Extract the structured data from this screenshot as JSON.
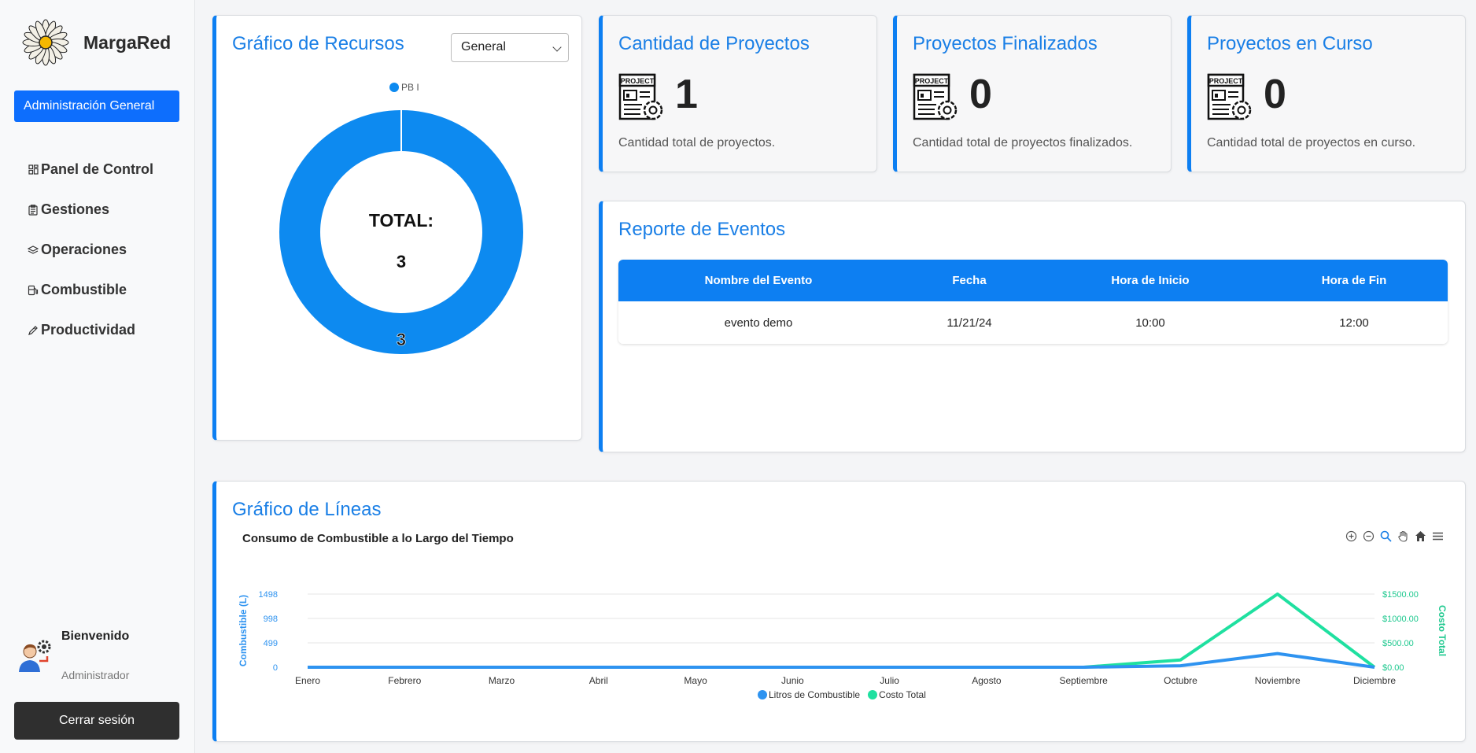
{
  "sidebar": {
    "brand": "MargaRed",
    "admin_button": "Administración General",
    "items": [
      {
        "label": "Panel de Control",
        "icon": "dashboard-icon"
      },
      {
        "label": "Gestiones",
        "icon": "clipboard-icon"
      },
      {
        "label": "Operaciones",
        "icon": "layers-icon"
      },
      {
        "label": "Combustible",
        "icon": "fuel-pump-icon"
      },
      {
        "label": "Productividad",
        "icon": "pencil-icon"
      }
    ],
    "welcome_title": "Bienvenido",
    "welcome_role": "Administrador",
    "logout": "Cerrar sesión"
  },
  "resources": {
    "title": "Gráfico de Recursos",
    "select_value": "General",
    "legend": "PB I",
    "total_label": "TOTAL:",
    "total_value": "3",
    "slice_label": "3"
  },
  "stats": [
    {
      "title": "Cantidad de Proyectos",
      "value": "1",
      "desc": "Cantidad total de proyectos."
    },
    {
      "title": "Proyectos Finalizados",
      "value": "0",
      "desc": "Cantidad total de proyectos finalizados."
    },
    {
      "title": "Proyectos en Curso",
      "value": "0",
      "desc": "Cantidad total de proyectos en curso."
    }
  ],
  "events": {
    "title": "Reporte de Eventos",
    "headers": [
      "Nombre del Evento",
      "Fecha",
      "Hora de Inicio",
      "Hora de Fin"
    ],
    "rows": [
      [
        "evento demo",
        "11/21/24",
        "10:00",
        "12:00"
      ]
    ]
  },
  "lines": {
    "title": "Gráfico de Líneas",
    "chart_title": "Consumo de Combustible a lo Largo del Tiempo"
  },
  "colors": {
    "accent": "#0d7ff2",
    "series_litros": "#2e93f0",
    "series_costo": "#1fe0a0"
  },
  "chart_data": [
    {
      "type": "pie",
      "labels": [
        "PB I"
      ],
      "values": [
        3
      ],
      "total_label": "TOTAL:",
      "total": 3,
      "legend_position": "top"
    },
    {
      "type": "line",
      "title": "Consumo de Combustible a lo Largo del Tiempo",
      "categories": [
        "Enero",
        "Febrero",
        "Marzo",
        "Abril",
        "Mayo",
        "Junio",
        "Julio",
        "Agosto",
        "Septiembre",
        "Octubre",
        "Noviembre",
        "Diciembre"
      ],
      "ylabel": "Combustible (L)",
      "ylabel_right": "Costo Total",
      "y_ticks": [
        "0",
        "499",
        "998",
        "1498"
      ],
      "y_right_ticks": [
        "$0.00",
        "$500.00",
        "$1000.00",
        "$1500.00"
      ],
      "ylim": [
        0,
        1498
      ],
      "ylim_right": [
        0,
        1500
      ],
      "series": [
        {
          "name": "Litros de Combustible",
          "axis": "left",
          "values": [
            0,
            0,
            0,
            0,
            0,
            0,
            0,
            0,
            0,
            30,
            280,
            0
          ]
        },
        {
          "name": "Costo Total",
          "axis": "right",
          "values": [
            0,
            0,
            0,
            0,
            0,
            0,
            0,
            0,
            0,
            150,
            1500,
            0
          ]
        }
      ],
      "grid": true,
      "legend_position": "bottom"
    }
  ]
}
